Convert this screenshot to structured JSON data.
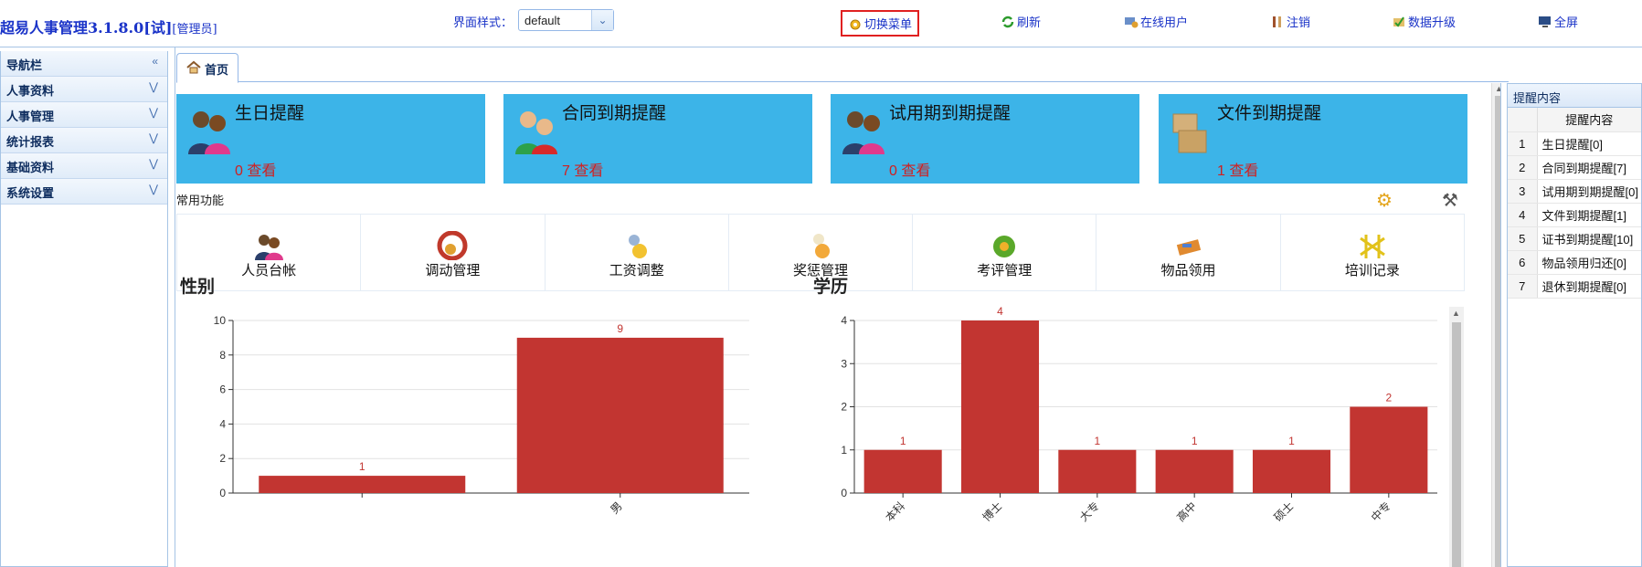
{
  "app": {
    "title": "超易人事管理3.1.8.0[试]",
    "role": "[管理员]"
  },
  "style": {
    "label": "界面样式：",
    "value": "default"
  },
  "toolbar": [
    {
      "label": "切换菜单",
      "icon": "switch-menu-icon",
      "highlight": true
    },
    {
      "label": "刷新",
      "icon": "refresh-icon"
    },
    {
      "label": "在线用户",
      "icon": "online-users-icon"
    },
    {
      "label": "注销",
      "icon": "logout-icon"
    },
    {
      "label": "数据升级",
      "icon": "data-upgrade-icon"
    },
    {
      "label": "全屏",
      "icon": "fullscreen-icon"
    }
  ],
  "nav": {
    "title": "导航栏",
    "items": [
      "人事资料",
      "人事管理",
      "统计报表",
      "基础资料",
      "系统设置"
    ]
  },
  "tab": {
    "label": "首页"
  },
  "cards": [
    {
      "title": "生日提醒",
      "count": "0 查看",
      "icon": "people-icon"
    },
    {
      "title": "合同到期提醒",
      "count": "7 查看",
      "icon": "contract-people-icon"
    },
    {
      "title": "试用期到期提醒",
      "count": "0 查看",
      "icon": "people-icon"
    },
    {
      "title": "文件到期提醒",
      "count": "1 查看",
      "icon": "boxes-icon"
    }
  ],
  "common": {
    "title": "常用功能",
    "items": [
      {
        "label": "人员台帐",
        "icon": "people-ledger-icon"
      },
      {
        "label": "调动管理",
        "icon": "transfer-icon"
      },
      {
        "label": "工资调整",
        "icon": "salary-icon"
      },
      {
        "label": "奖惩管理",
        "icon": "reward-icon"
      },
      {
        "label": "考评管理",
        "icon": "evaluation-icon"
      },
      {
        "label": "物品领用",
        "icon": "items-icon"
      },
      {
        "label": "培训记录",
        "icon": "training-icon"
      }
    ]
  },
  "chart_data": [
    {
      "type": "bar",
      "title": "性别",
      "categories": [
        "",
        "男"
      ],
      "values": [
        1,
        9
      ],
      "ylim": [
        0,
        10
      ],
      "yticks": [
        0,
        2,
        4,
        6,
        8,
        10
      ],
      "color": "#c23531",
      "grid": true
    },
    {
      "type": "bar",
      "title": "学历",
      "categories": [
        "本科",
        "博士",
        "大专",
        "高中",
        "硕士",
        "中专"
      ],
      "values": [
        1,
        4,
        1,
        1,
        1,
        2
      ],
      "ylim": [
        0,
        4
      ],
      "yticks": [
        0,
        1,
        2,
        3,
        4
      ],
      "color": "#c23531",
      "grid": true
    }
  ],
  "reminders": {
    "title": "提醒内容",
    "column": "提醒内容",
    "rows": [
      {
        "no": "1",
        "text": "生日提醒[0]"
      },
      {
        "no": "2",
        "text": "合同到期提醒[7]"
      },
      {
        "no": "3",
        "text": "试用期到期提醒[0]"
      },
      {
        "no": "4",
        "text": "文件到期提醒[1]"
      },
      {
        "no": "5",
        "text": "证书到期提醒[10]"
      },
      {
        "no": "6",
        "text": "物品领用归还[0]"
      },
      {
        "no": "7",
        "text": "退休到期提醒[0]"
      }
    ]
  }
}
